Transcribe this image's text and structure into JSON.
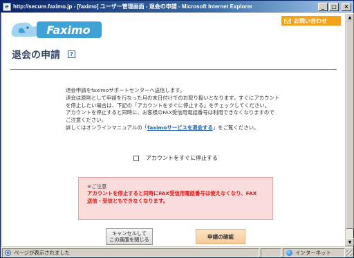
{
  "window": {
    "title": "http://secure.faximo.jp - [faximo] ユーザー管理画面 - 退会の申請 - Microsoft Internet Explorer",
    "minimize_glyph": "_",
    "maximize_glyph": "□",
    "close_glyph": "×"
  },
  "header": {
    "logo_text": "Faximo",
    "contact_label": "お問い合わせ"
  },
  "page": {
    "title": "退会の申請",
    "help_glyph": "?",
    "description": {
      "line1": "退会申請をfaximoサポートセンターへ送信します。",
      "line2": "退会は原則として申請を行なった月の末日付けでのお取り扱いとなります。すぐにアカウント",
      "line3": "を停止したい場合は、下記の「アカウントをすぐに停止する」をチェックしてください。",
      "line4": "アカウントを停止すると同時に、お客様のFAX受信用電話番号は利用できなくなりますので",
      "line5": "ご注意ください。",
      "line6_prefix": "詳しくはオンラインマニュアルの「",
      "link": "faximoサービスを退会する",
      "line6_suffix": "」をご覧ください。"
    },
    "checkbox_label": "アカウントをすぐに停止する",
    "notice": {
      "head": "※ご注意",
      "line1": "アカウントを停止すると同時にFAX受信用電話番号は使えなくなり、FAX",
      "line2": "送信・受信ともできなくなります。"
    },
    "cancel_button_line1": "キャンセルして",
    "cancel_button_line2": "この画面を閉じる",
    "confirm_button": "申請の確認"
  },
  "status": {
    "left": "ページが表示されました",
    "zone": "インターネット"
  },
  "colors": {
    "accent": "#f3a21b",
    "title": "#3a4a66",
    "link": "#1a5fae",
    "warning": "#e01010"
  }
}
